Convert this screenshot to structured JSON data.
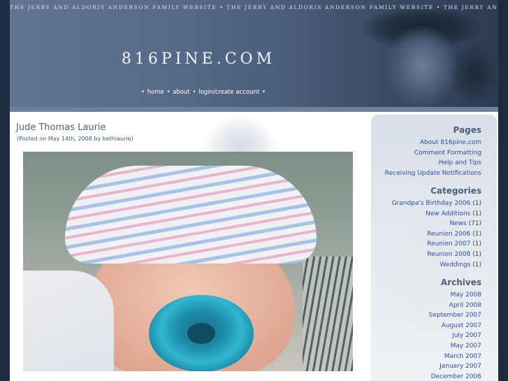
{
  "header": {
    "banner_text": "THE JERRY AND ALDORIS ANDERSON FAMILY WEBSITE • THE JERRY AND ALDORIS ANDERSON FAMILY WEBSITE • THE JERRY AND ALDORIS",
    "site_title": "816PINE.COM",
    "nav": {
      "bullet": "•",
      "home": "home",
      "about": "about",
      "login": "login/create account"
    }
  },
  "post": {
    "title": "Jude Thomas Laurie",
    "meta": "(Posted on May 14th, 2008 by bethlaurie)"
  },
  "sidebar": {
    "pages_heading": "Pages",
    "pages": [
      "About 816pine.com",
      "Comment Formatting",
      "Help and Tips",
      "Receiving Update Notifications"
    ],
    "categories_heading": "Categories",
    "categories": [
      {
        "name": "Grandpa's Birthday 2006",
        "count": "(1)"
      },
      {
        "name": "New Additions",
        "count": "(1)"
      },
      {
        "name": "News",
        "count": "(71)"
      },
      {
        "name": "Reunion 2006",
        "count": "(1)"
      },
      {
        "name": "Reunion 2007",
        "count": "(1)"
      },
      {
        "name": "Reunion 2008",
        "count": "(1)"
      },
      {
        "name": "Weddings",
        "count": "(1)"
      }
    ],
    "archives_heading": "Archives",
    "archives": [
      "May 2008",
      "April 2008",
      "September 2007",
      "August 2007",
      "July 2007",
      "May 2007",
      "March 2007",
      "January 2007",
      "December 2006"
    ]
  }
}
